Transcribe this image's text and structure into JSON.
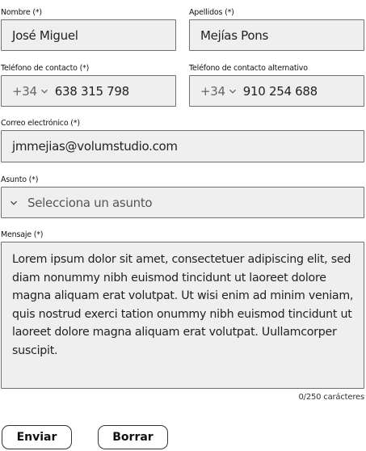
{
  "form": {
    "nombre": {
      "label": "Nombre (*)",
      "value": "José Miguel"
    },
    "apellidos": {
      "label": "Apellidos (*)",
      "value": "Mejías Pons"
    },
    "telefono": {
      "label": "Teléfono de contacto (*)",
      "prefix": "+34",
      "value": "638 315 798"
    },
    "telefono_alt": {
      "label": "Teléfono de contacto alternativo",
      "prefix": "+34",
      "value": "910 254 688"
    },
    "correo": {
      "label": "Correo electrónico (*)",
      "value": "jmmejias@volumstudio.com"
    },
    "asunto": {
      "label": "Asunto (*)",
      "placeholder": "Selecciona un asunto",
      "icon": "chevron-down-icon"
    },
    "mensaje": {
      "label": "Mensaje (*)",
      "value": "Lorem ipsum dolor sit amet, consectetuer adipiscing elit, sed diam nonummy nibh euismod tincidunt ut laoreet dolore magna aliquam erat volutpat. Ut wisi enim ad minim veniam, quis nostrud exerci tation onummy nibh euismod tincidunt ut laoreet dolore magna aliquam erat volutpat. Uullamcorper suscipit.",
      "counter": "0/250 carácteres"
    }
  },
  "buttons": {
    "enviar": "Enviar",
    "borrar": "Borrar"
  },
  "colors": {
    "field_bg": "#efefef",
    "border": "#707070"
  }
}
